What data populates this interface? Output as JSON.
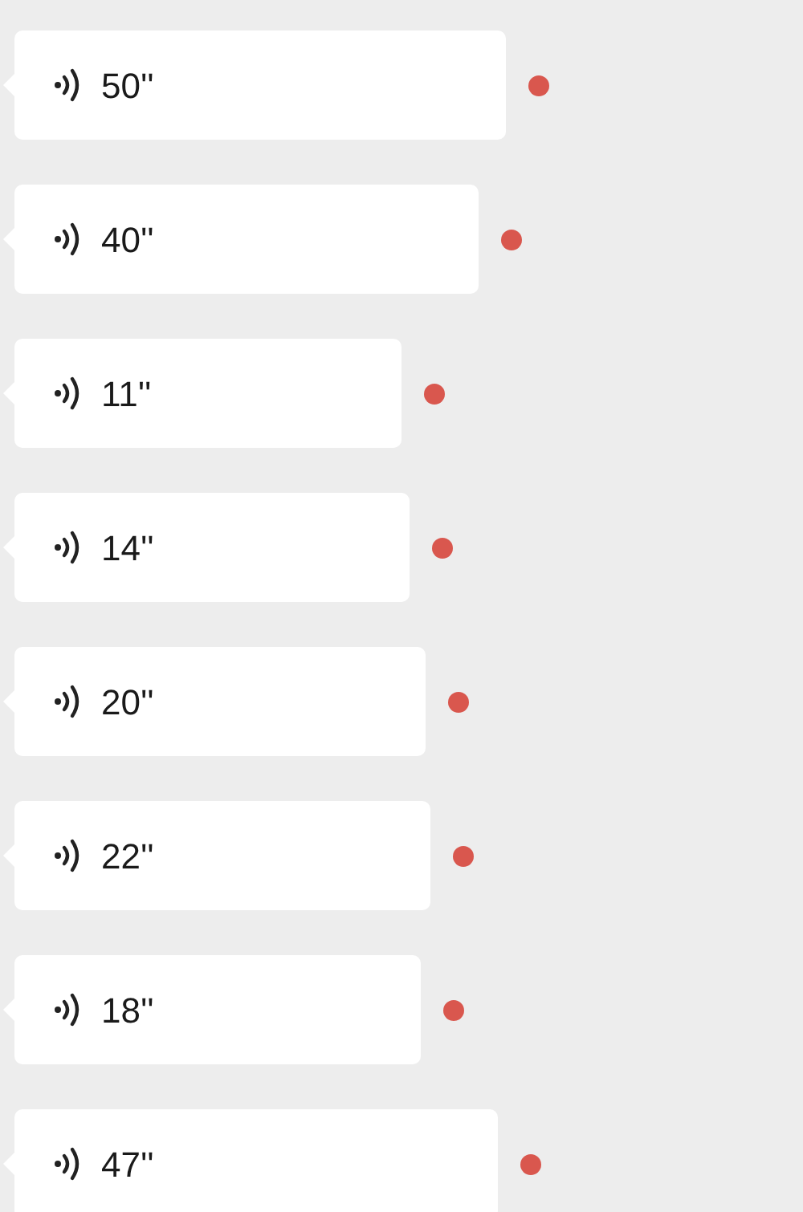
{
  "messages": [
    {
      "duration": "50''",
      "unread": true
    },
    {
      "duration": "40''",
      "unread": true
    },
    {
      "duration": "11''",
      "unread": true
    },
    {
      "duration": "14''",
      "unread": true
    },
    {
      "duration": "20''",
      "unread": true
    },
    {
      "duration": "22''",
      "unread": true
    },
    {
      "duration": "18''",
      "unread": true
    },
    {
      "duration": "47''",
      "unread": true
    }
  ]
}
